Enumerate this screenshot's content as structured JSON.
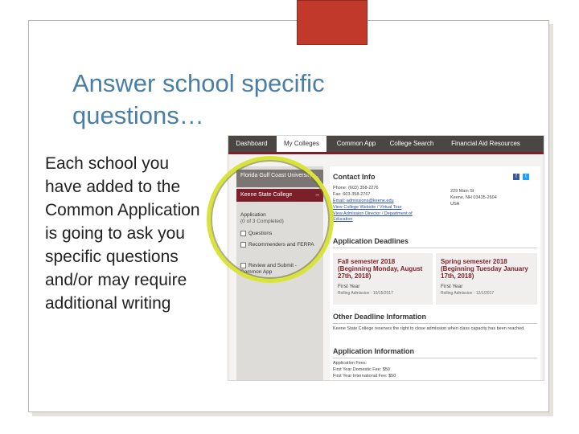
{
  "slide": {
    "title": "Answer school specific questions…",
    "body": "Each school you have added to the Common Application is going to ask you specific questions and/or may require additional writing"
  },
  "colors": {
    "title": "#4a7fa5",
    "accent": "#c0392b",
    "nav": "#4a4644",
    "brand": "#7d1f2a",
    "highlight_ring": "#d8e43a"
  },
  "app": {
    "nav": {
      "tabs": [
        {
          "label": "Dashboard"
        },
        {
          "label": "My Colleges"
        },
        {
          "label": "Common App"
        },
        {
          "label": "College Search"
        },
        {
          "label": "Financial Aid Resources"
        }
      ],
      "active": "My Colleges"
    },
    "sidebar": {
      "colleges": [
        {
          "label": "Florida Gulf Coast University",
          "symbol": "+"
        },
        {
          "label": "Keene State College",
          "symbol": "–"
        }
      ],
      "application_heading": "Application",
      "application_progress": "(0 of 3 Completed)",
      "items": [
        {
          "label": "Questions"
        },
        {
          "label": "Recommenders and FERPA"
        },
        {
          "label": "Review and Submit - Common App"
        }
      ]
    },
    "contact": {
      "title": "Contact Info",
      "phone": "Phone: (603) 358-2276",
      "fax": "Fax: 603-358-2767",
      "email": "Email: admissions@keene.edu",
      "website": "View College Website / Virtual Tour",
      "director": "View Admission Director / Department of Education",
      "address_1": "229 Main St",
      "address_2": "Keene, NH 03435-2604",
      "address_3": "USA",
      "social_f": "f",
      "social_t": "t"
    },
    "deadlines": {
      "title": "Application Deadlines",
      "fall": {
        "title": "Fall semester 2018 (Beginning Monday, August 27th, 2018)",
        "type": "First Year",
        "detail": "Rolling Admission - 10/15/2017"
      },
      "spring": {
        "title": "Spring semester 2018 (Beginning Tuesday January 17th, 2018)",
        "type": "First Year",
        "detail": "Rolling Admission - 12/1/2017"
      }
    },
    "other": {
      "title": "Other Deadline Information",
      "text": "Keene State College reserves the right to close admission when class capacity has been reached."
    },
    "info": {
      "title": "Application Information",
      "fees_label": "Application Fees:",
      "fee_domestic": "First Year Domestic Fee: $50",
      "fee_intl": "First Year International Fee: $50"
    }
  }
}
